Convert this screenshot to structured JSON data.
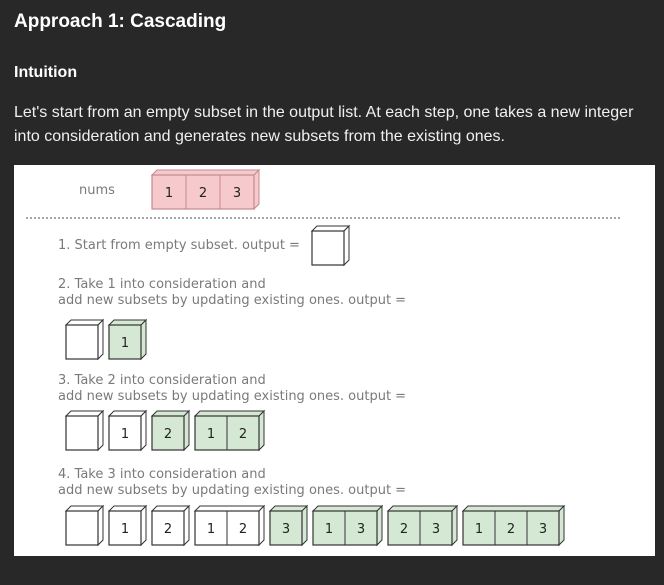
{
  "title": "Approach 1: Cascading",
  "subtitle": "Intuition",
  "paragraph": "Let's start from an empty subset in the output list. At each step, one takes a new integer into consideration and generates new subsets from the existing ones.",
  "diagram": {
    "nums_label": "nums",
    "nums": [
      "1",
      "2",
      "3"
    ],
    "step1": "1. Start from empty subset. output =",
    "step2_line1": "2. Take 1 into consideration and",
    "step2_line2": "add new subsets by updating existing ones. output =",
    "step3_line1": "3. Take 2 into consideration and",
    "step3_line2": "add new subsets by updating existing ones. output =",
    "step4_line1": "4. Take 3 into consideration and",
    "step4_line2": "add new subsets by updating existing ones. output =",
    "colors": {
      "pink": "#f6c9cc",
      "green": "#d5e8d4",
      "line": "#333333"
    }
  }
}
